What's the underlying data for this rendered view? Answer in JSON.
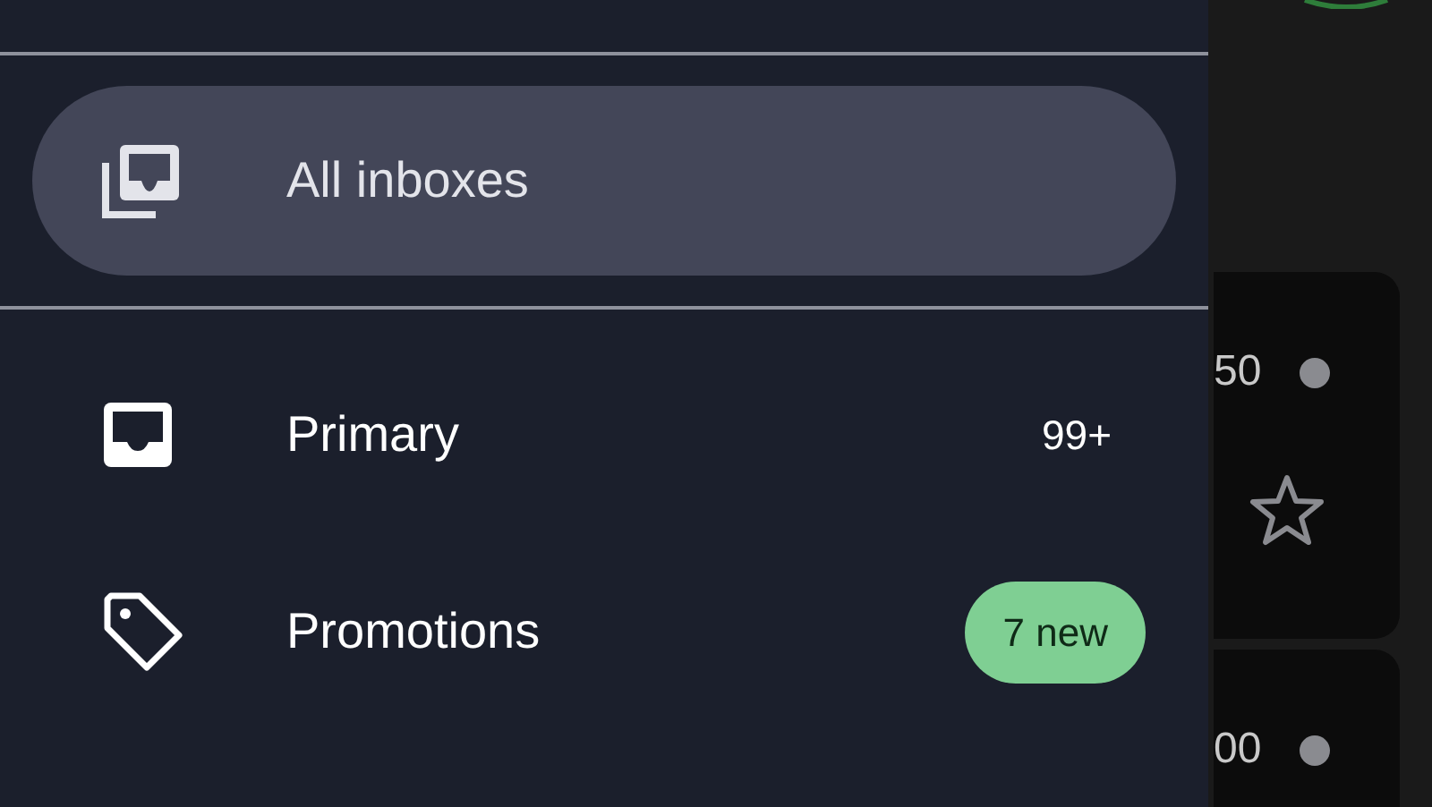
{
  "drawer": {
    "items": [
      {
        "kind": "all-inboxes",
        "label": "All inboxes",
        "selected": true
      },
      {
        "kind": "inbox",
        "label": "Primary",
        "selected": false,
        "count": "99+"
      },
      {
        "kind": "tag",
        "label": "Promotions",
        "selected": false,
        "badge": "7 new"
      }
    ]
  },
  "mail_list": {
    "items": [
      {
        "kind": "with-star",
        "time": "50"
      },
      {
        "kind": "cut-off",
        "time": "00"
      }
    ]
  }
}
